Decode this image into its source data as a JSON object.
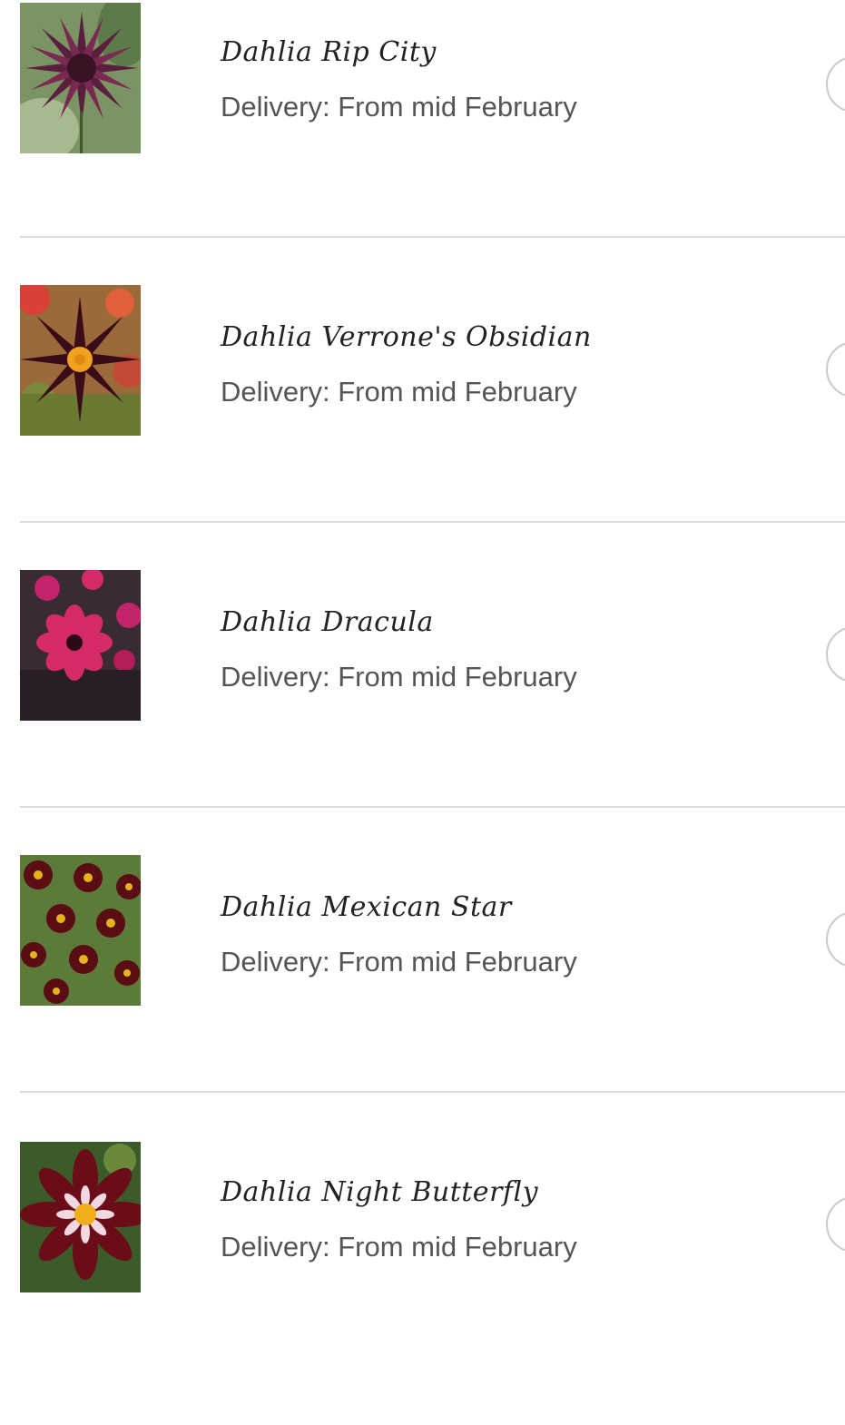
{
  "products": [
    {
      "name": "Dahlia Rip City",
      "delivery": "Delivery: From mid February",
      "image_icon": "dahlia-rip-city-photo",
      "colors": {
        "bg": "#6f8a5a",
        "petal": "#5a1f3e",
        "center": "#3a1226"
      }
    },
    {
      "name": "Dahlia Verrone's Obsidian",
      "delivery": "Delivery: From mid February",
      "image_icon": "dahlia-verrones-obsidian-photo",
      "colors": {
        "bg": "#b7533e",
        "petal": "#3a0c18",
        "center": "#f0a21e"
      }
    },
    {
      "name": "Dahlia Dracula",
      "delivery": "Delivery: From mid February",
      "image_icon": "dahlia-dracula-photo",
      "colors": {
        "bg": "#3a2a33",
        "petal": "#d42a6a",
        "center": "#2a0a14"
      }
    },
    {
      "name": "Dahlia Mexican Star",
      "delivery": "Delivery: From mid February",
      "image_icon": "dahlia-mexican-star-photo",
      "colors": {
        "bg": "#5c7a3a",
        "petal": "#5a0d12",
        "center": "#e8b21e"
      }
    },
    {
      "name": "Dahlia Night Butterfly",
      "delivery": "Delivery: From mid February",
      "image_icon": "dahlia-night-butterfly-photo",
      "colors": {
        "bg": "#3d5a2a",
        "petal": "#6a0d18",
        "center": "#f0b01e"
      }
    }
  ]
}
